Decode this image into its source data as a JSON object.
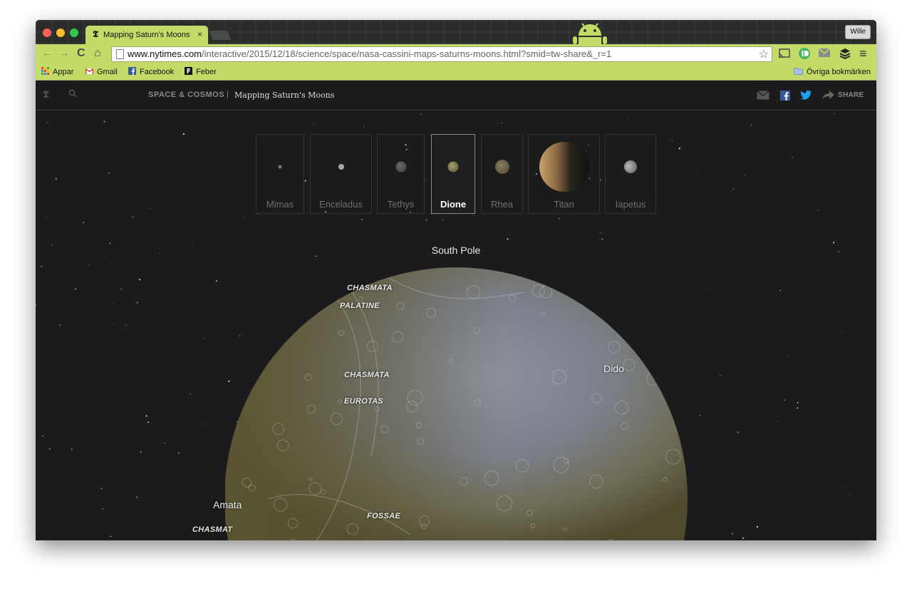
{
  "browser": {
    "tab_title": "Mapping Saturn's Moons",
    "tab_favicon": "𝕿",
    "tab_close": "×",
    "profile": "Wille",
    "url_host": "www.nytimes.com",
    "url_path": "/interactive/2015/12/18/science/space/nasa-cassini-maps-saturns-moons.html?smid=tw-share&_r=1",
    "nav": {
      "back": "←",
      "forward": "→",
      "reload": "C",
      "home": "⌂"
    },
    "star": "☆",
    "menu": "≡"
  },
  "bookmarks": {
    "items": [
      {
        "label": "Appar",
        "icon": "apps-icon"
      },
      {
        "label": "Gmail",
        "icon": "gmail-icon"
      },
      {
        "label": "Facebook",
        "icon": "facebook-icon"
      },
      {
        "label": "Feber",
        "icon": "feber-icon"
      }
    ],
    "other": "Övriga bokmärken"
  },
  "nyt": {
    "logo": "𝕿",
    "section": "SPACE & COSMOS",
    "separator": "|",
    "headline": "Mapping Saturn's Moons",
    "share": "SHARE"
  },
  "moons": [
    {
      "name": "Mimas",
      "active": false
    },
    {
      "name": "Enceladus",
      "active": false
    },
    {
      "name": "Tethys",
      "active": false
    },
    {
      "name": "Dione",
      "active": true
    },
    {
      "name": "Rhea",
      "active": false
    },
    {
      "name": "Titan",
      "active": false
    },
    {
      "name": "Iapetus",
      "active": false
    }
  ],
  "map": {
    "view_label": "South Pole",
    "features": {
      "chasmata1": "CHASMATA",
      "palatine": "PALATINE",
      "chasmata2": "CHASMATA",
      "eurotas": "EUROTAS",
      "fossae": "FOSSAE",
      "chasmata3": "CHASMAT",
      "dido": "Dido",
      "amata": "Amata"
    }
  },
  "colors": {
    "browser_theme": "#c5db68",
    "page_bg": "#1b1b1d",
    "facebook": "#3b5998",
    "twitter": "#1da1f2"
  }
}
